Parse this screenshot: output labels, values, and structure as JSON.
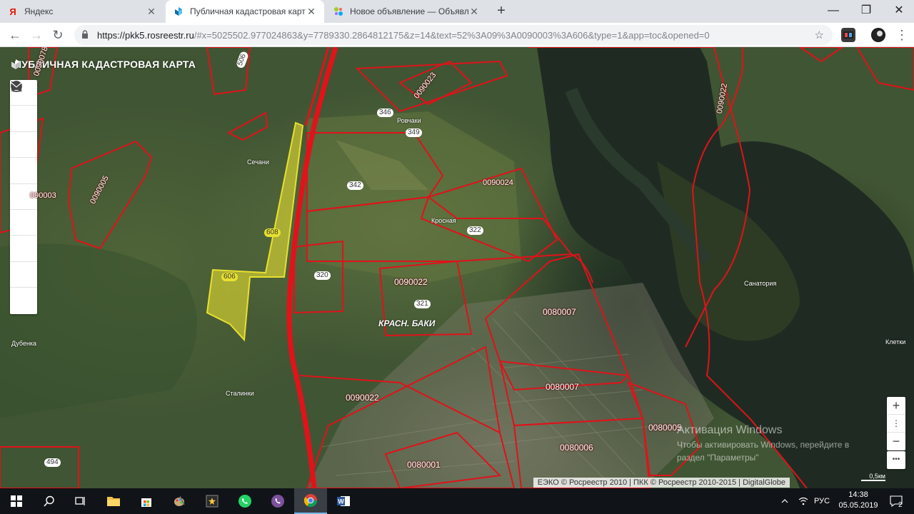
{
  "browser": {
    "tabs": [
      {
        "title": "Яндекс",
        "icon": "yandex-icon"
      },
      {
        "title": "Публичная кадастровая карта",
        "icon": "rosreestr-icon",
        "active": true
      },
      {
        "title": "Новое объявление — Объявлен",
        "icon": "avito-icon"
      }
    ],
    "url_host": "https://pkk5.rosreestr.ru",
    "url_rest": "/#x=5025502.977024863&y=7789330.2864812175&z=14&text=52%3A09%3A0090003%3A606&type=1&app=toc&opened=0"
  },
  "map": {
    "title": "ПУБЛИЧНАЯ КАДАСТРОВАЯ КАРТА",
    "tools": [
      "layers-icon",
      "search-icon",
      "info-icon",
      "pencil-icon",
      "measure-icon",
      "star-icon",
      "print-icon",
      "help-icon",
      "mail-icon"
    ],
    "parcel_labels": [
      {
        "text": "0090023"
      },
      {
        "text": "0090022"
      },
      {
        "text": "0090005"
      },
      {
        "text": "090003"
      },
      {
        "text": "0090024"
      },
      {
        "text": "0090022"
      },
      {
        "text": "0080007"
      },
      {
        "text": "0090022"
      },
      {
        "text": "0080007"
      },
      {
        "text": "0080006"
      },
      {
        "text": "0080005"
      },
      {
        "text": "0080001"
      },
      {
        "text": "0090078"
      }
    ],
    "small_numbers": [
      "346",
      "349",
      "342",
      "322",
      "608",
      "606",
      "320",
      "321",
      "494",
      "506"
    ],
    "places": [
      "Ровчаки",
      "Кросная",
      "Сечани",
      "Дубенка",
      "Сталинки",
      "Санатория",
      "Клетки"
    ],
    "town_label": "КРАСН. БАКИ",
    "attribution": "ЕЭКО © Росреестр 2010 | ПКК © Росреестр 2010-2015 | DigitalGlobe",
    "scale": "0,5км",
    "zoom_in": "+",
    "zoom_out": "−",
    "more": "•••",
    "watermark_title": "Активация Windows",
    "watermark_line1": "Чтобы активировать Windows, перейдите в",
    "watermark_line2": "раздел \"Параметры\""
  },
  "taskbar": {
    "lang": "РУС",
    "time": "14:38",
    "date": "05.05.2019",
    "notifications": "2"
  },
  "colors": {
    "parcel_border": "#e0121a",
    "selected_fill": "#e8e030",
    "road": "#e3121a"
  }
}
